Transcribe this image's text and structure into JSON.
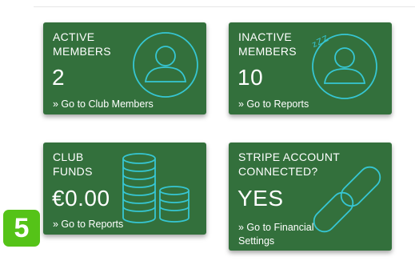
{
  "cards": [
    {
      "title": "ACTIVE\nMEMBERS",
      "value": "2",
      "link": "» Go to Club Members",
      "icon": "user-icon"
    },
    {
      "title": "INACTIVE\nMEMBERS",
      "value": "10",
      "link": "» Go to Reports",
      "icon": "sleeping-user-icon",
      "sleep_glyph": "zZZ"
    },
    {
      "title": "CLUB\nFUNDS",
      "value": "€0.00",
      "link": "» Go to Reports",
      "icon": "coins-icon"
    },
    {
      "title": "STRIPE ACCOUNT\nCONNECTED?",
      "value": "YES",
      "link": "» Go to Financial\nSettings",
      "icon": "chain-link-icon"
    }
  ],
  "badge": "5",
  "colors": {
    "card_bg": "#33703c",
    "icon_stroke": "#36c6d3",
    "badge_bg": "#55c318",
    "text": "#ffffff"
  }
}
